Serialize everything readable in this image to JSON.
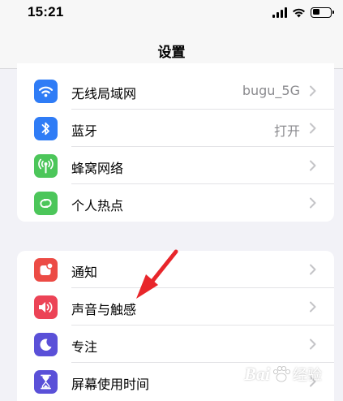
{
  "status": {
    "time": "15:21"
  },
  "nav": {
    "title": "设置"
  },
  "group1": [
    {
      "label": "无线局域网",
      "value": "bugu_5G",
      "icon": "wifi-icon",
      "color": "#2f7cf6"
    },
    {
      "label": "蓝牙",
      "value": "打开",
      "icon": "bluetooth-icon",
      "color": "#2f7cf6"
    },
    {
      "label": "蜂窝网络",
      "value": "",
      "icon": "antenna-icon",
      "color": "#4cc65a"
    },
    {
      "label": "个人热点",
      "value": "",
      "icon": "hotspot-icon",
      "color": "#4cc65a"
    }
  ],
  "group2": [
    {
      "label": "通知",
      "icon": "notification-icon",
      "color": "#ec4b45"
    },
    {
      "label": "声音与触感",
      "icon": "speaker-icon",
      "color": "#ec4356"
    },
    {
      "label": "专注",
      "icon": "moon-icon",
      "color": "#5a50d8"
    },
    {
      "label": "屏幕使用时间",
      "icon": "hourglass-icon",
      "color": "#5a50d8"
    }
  ],
  "watermark": {
    "text": "Bai",
    "cn": "经验"
  }
}
